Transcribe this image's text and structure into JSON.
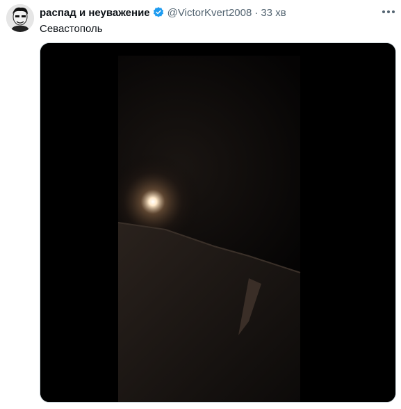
{
  "tweet": {
    "author_name": "распад и неуважение",
    "handle": "@VictorKvert2008",
    "separator": "·",
    "time": "33 хв",
    "text": "Севастополь",
    "media_type": "video",
    "verified": true
  },
  "icons": {
    "verified": "verified-badge-icon",
    "more": "more-options-icon",
    "avatar": "avatar-image"
  },
  "colors": {
    "verified": "#1d9bf0",
    "secondary_text": "#536471",
    "primary_text": "#0f1419"
  }
}
